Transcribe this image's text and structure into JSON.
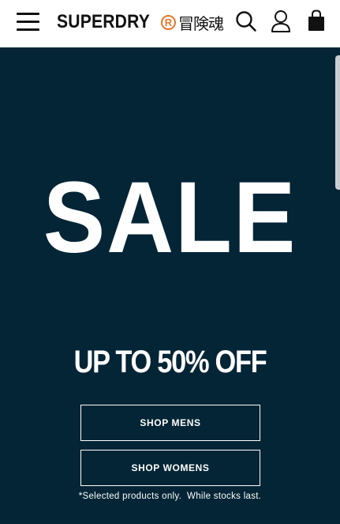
{
  "header": {
    "menu_icon": "hamburger-menu-icon",
    "brand": {
      "wordmark": "SUPERDRY",
      "registered_mark": "R",
      "japanese": "冒険魂",
      "accent_color": "#e8772e"
    },
    "search_icon": "search-icon",
    "account_icon": "user-account-icon",
    "bag_icon": "shopping-bag-icon"
  },
  "hero": {
    "background_color": "#032536",
    "title": "SALE",
    "subtitle": "UP TO 50% OFF",
    "buttons": {
      "shop_mens": "SHOP MENS",
      "shop_womens": "SHOP WOMENS"
    },
    "disclaimer": "*Selected products only.  While stocks last."
  }
}
